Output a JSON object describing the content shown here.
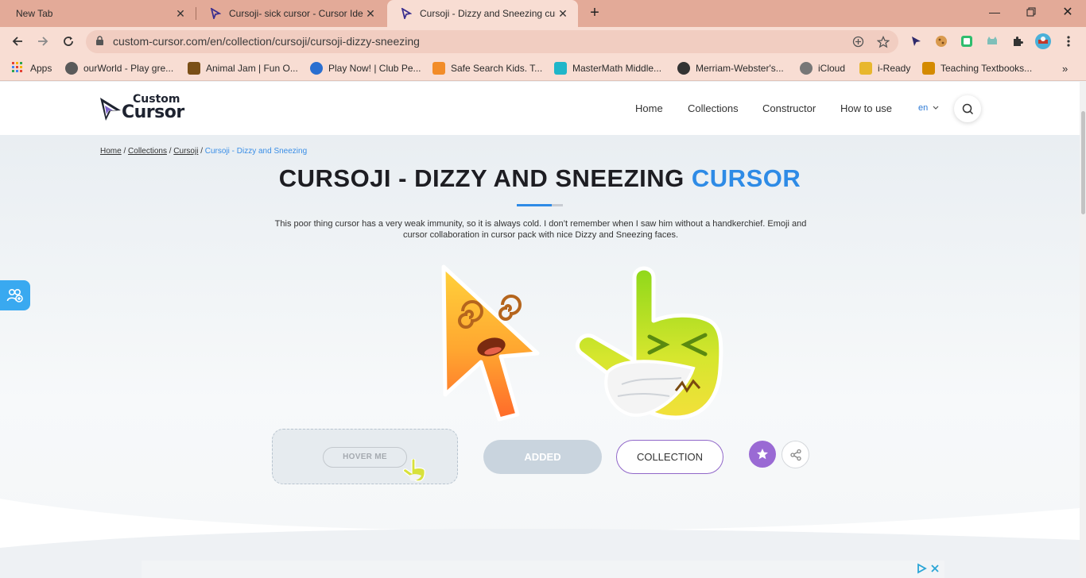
{
  "browser": {
    "tabs": [
      {
        "title": "New Tab"
      },
      {
        "title": "Cursoji- sick cursor - Cursor Ideas"
      },
      {
        "title": "Cursoji - Dizzy and Sneezing cursor"
      }
    ],
    "url": "custom-cursor.com/en/collection/cursoji/cursoji-dizzy-sneezing",
    "bookmarks": [
      {
        "label": "Apps"
      },
      {
        "label": "ourWorld - Play gre..."
      },
      {
        "label": "Animal Jam | Fun O..."
      },
      {
        "label": "Play Now! | Club Pe..."
      },
      {
        "label": "Safe Search Kids. T..."
      },
      {
        "label": "MasterMath Middle..."
      },
      {
        "label": "Merriam-Webster's..."
      },
      {
        "label": "iCloud"
      },
      {
        "label": "i-Ready"
      },
      {
        "label": "Teaching Textbooks..."
      }
    ]
  },
  "site": {
    "logo_top": "Custom",
    "logo_bottom": "Cursor",
    "nav": {
      "home": "Home",
      "collections": "Collections",
      "constructor": "Constructor",
      "how_to_use": "How to use",
      "lang": "en"
    }
  },
  "breadcrumb": {
    "home": "Home",
    "collections": "Collections",
    "cursoji": "Cursoji",
    "current": "Cursoji - Dizzy and Sneezing",
    "sep": "/"
  },
  "page": {
    "title_main": "CURSOJI - DIZZY AND SNEEZING",
    "title_accent": "CURSOR",
    "description": "This poor thing cursor has a very weak immunity, so it is always cold. I don’t remember when I saw him without a handkerchief. Emoji and cursor collaboration in cursor pack with nice Dizzy and Sneezing faces."
  },
  "actions": {
    "hover_label": "HOVER ME",
    "added_label": "ADDED",
    "collection_label": "COLLECTION"
  },
  "colors": {
    "accent": "#2e8be6",
    "tab_strip": "#e3aa98",
    "toolbar": "#f8ddd3",
    "purple": "#9a6ad4"
  }
}
